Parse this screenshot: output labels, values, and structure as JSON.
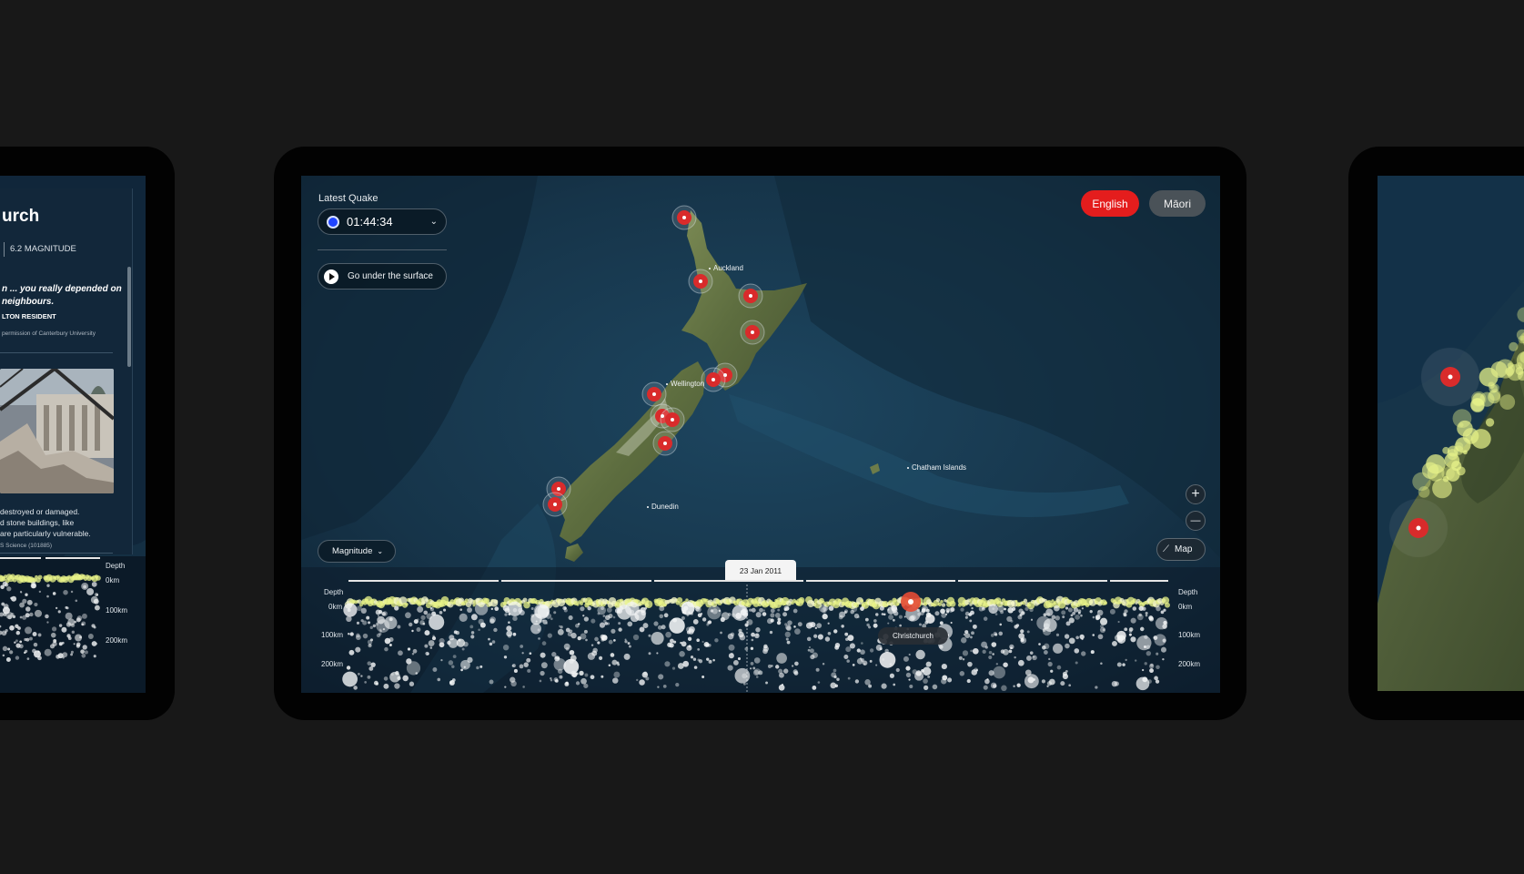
{
  "left_panel": {
    "title": "urch",
    "magnitude": "6.2 MAGNITUDE",
    "quote_line1": "n ... you really depended on",
    "quote_line2": "neighbours.",
    "attribution": "LTON RESIDENT",
    "credit": "permission of Canterbury University",
    "body_line1": "destroyed or damaged.",
    "body_line2": "d stone buildings, like",
    "body_line3": "are particularly vulnerable.",
    "source": "S Science (101885)",
    "depth_header": "Depth",
    "depth_0": "0km",
    "depth_100": "100km",
    "depth_200": "200km"
  },
  "header": {
    "latest_quake_label": "Latest Quake",
    "latest_quake_time": "01:44:34",
    "go_under_surface_label": "Go under the surface"
  },
  "language": {
    "english_label": "English",
    "maori_label": "Māori",
    "active": "English"
  },
  "map": {
    "places": {
      "auckland": "Auckland",
      "wellington": "Wellington",
      "dunedin": "Dunedin",
      "chatham": "Chatham Islands"
    },
    "zoom_in_label": "+",
    "zoom_out_label": "—",
    "map_toggle_label": "Map",
    "magnitude_filter_label": "Magnitude"
  },
  "timeline": {
    "depth_header": "Depth",
    "depth_ticks": [
      "0km",
      "100km",
      "200km"
    ],
    "selected_date": "23 Jan 2011",
    "highlight_label": "Christchurch"
  },
  "colors": {
    "accent_red": "#e41d1d",
    "quake_dot_blue": "#1f44ff",
    "shallow_quake_yellow": "#e9f48a"
  },
  "icons": {
    "quake_select_chevron": "chevron-down-icon",
    "play": "play-icon",
    "map_toggle": "layers-icon"
  }
}
